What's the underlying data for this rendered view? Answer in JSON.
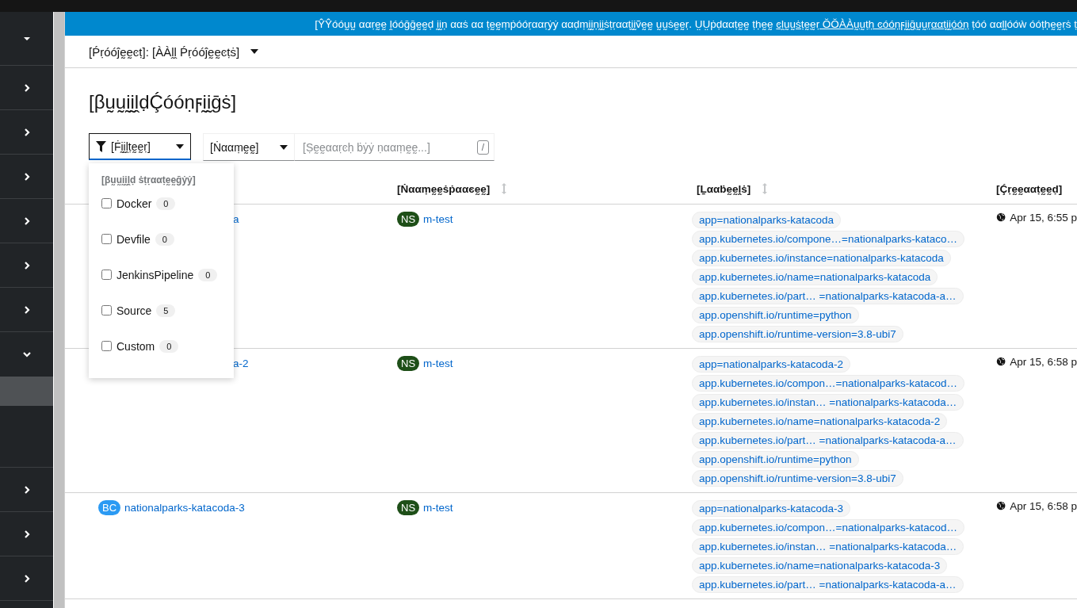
{
  "sidebar": {
    "items": [
      {
        "kind": "toggle"
      },
      {
        "kind": "collapsed"
      },
      {
        "kind": "collapsed"
      },
      {
        "kind": "collapsed"
      },
      {
        "kind": "collapsed"
      },
      {
        "kind": "collapsed"
      },
      {
        "kind": "collapsed"
      },
      {
        "kind": "expanded",
        "children": [
          {
            "selected": true
          },
          {
            "selected": false
          }
        ]
      },
      {
        "kind": "collapsed"
      },
      {
        "kind": "collapsed"
      },
      {
        "kind": "collapsed"
      }
    ]
  },
  "banner": {
    "text": "[ŶŶóóṵṵ ααṛḛḛ ḽóóḡḡḛḛḍ ḭḭṇ ααṡ αα ṭḛḛṃṗóóṛααṛẏẏ ααḍṃḭḭṇḭḭṡṭṛααṭḭḭṽḛḛ ṵṵṡḛḛṛ. ṲṲṗḍααṭḛḛ ṭḥḛḛ",
    "link": "ͼḽṵṵṡṭḛḛṛ ŎŎÀÀṵṵṭḥ ͼóóṇϝḭḭḡṵṵṛααṭḭḭóóṇ",
    "tail": "ṭóó ααḽḽóóẁ óóṭḥḛḛṛṡ ṭ"
  },
  "project_bar": {
    "label": "[Ṕṛóóĵḛḛͼṭ]: [ÀÀḽḽ Ṕṛóóĵḛḛͼṭṡ]"
  },
  "title": "[βṵṵḭḭḽḍḈóóṇϝḭḭḡṡ]",
  "toolbar": {
    "filter": {
      "label": "[Ḟḭḭḽṭḛḛṛ]",
      "expanded": true
    },
    "attribute": "[Ṅααṃḛḛ]",
    "search": {
      "placeholder": "[Ṣḛḛααṛͼḥ ḃẏẏ ṇααṃḛḛ...]",
      "shortcut": "/"
    }
  },
  "filter_menu": {
    "group": "[βṵṵḭḭḽḍ ṡṭṛααṭḛḛḡẏẏ]",
    "options": [
      {
        "label": "Docker",
        "count": "0",
        "checked": false
      },
      {
        "label": "Devfile",
        "count": "0",
        "checked": false
      },
      {
        "label": "JenkinsPipeline",
        "count": "0",
        "checked": false
      },
      {
        "label": "Source",
        "count": "5",
        "checked": false
      },
      {
        "label": "Custom",
        "count": "0",
        "checked": false
      }
    ]
  },
  "table": {
    "columns": [
      {
        "label": "[Ṅααṃḛḛṡṗααͼḛḛ]",
        "sortable": true
      },
      {
        "label": "[Ḻααḃḛḛḽṡ]",
        "sortable": true
      },
      {
        "label": "[Ḉṛḛḛααṭḛḛḍ]",
        "sortable": false
      }
    ],
    "rows": [
      {
        "name": "a",
        "occluded": true,
        "namespace_badge": "NS",
        "namespace": "m-test",
        "labels": [
          "app=nationalparks-katacoda",
          "app.kubernetes.io/compone…=nationalparks-kataco…",
          "app.kubernetes.io/instance=nationalparks-katacoda",
          "app.kubernetes.io/name=nationalparks-katacoda",
          "app.kubernetes.io/part…  =nationalparks-katacoda-a…",
          "app.openshift.io/runtime=python",
          "app.openshift.io/runtime-version=3.8-ubi7"
        ],
        "created": "Apr 15, 6:55 p"
      },
      {
        "name": "a-2",
        "occluded": true,
        "namespace_badge": "NS",
        "namespace": "m-test",
        "labels": [
          "app=nationalparks-katacoda-2",
          "app.kubernetes.io/compon…=nationalparks-katacod…",
          "app.kubernetes.io/instan…  =nationalparks-katacoda…",
          "app.kubernetes.io/name=nationalparks-katacoda-2",
          "app.kubernetes.io/part…  =nationalparks-katacoda-a…",
          "app.openshift.io/runtime=python",
          "app.openshift.io/runtime-version=3.8-ubi7"
        ],
        "created": "Apr 15, 6:58 p"
      },
      {
        "badge": "BC",
        "name": "nationalparks-katacoda-3",
        "occluded": false,
        "namespace_badge": "NS",
        "namespace": "m-test",
        "labels": [
          "app=nationalparks-katacoda-3",
          "app.kubernetes.io/compon…=nationalparks-katacod…",
          "app.kubernetes.io/instan…  =nationalparks-katacoda…",
          "app.kubernetes.io/name=nationalparks-katacoda-3",
          "app.kubernetes.io/part…  =nationalparks-katacoda-a…"
        ],
        "created": "Apr 15, 6:58 p"
      }
    ]
  }
}
